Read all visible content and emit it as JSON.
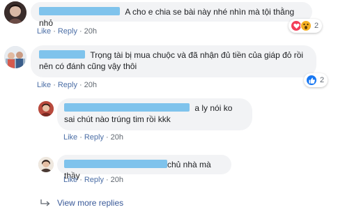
{
  "comments": [
    {
      "text": "A cho e chia se bài này nhé nhìn mà tội thằng nhỏ",
      "actions": {
        "like": "Like",
        "reply": "Reply",
        "time": "20h"
      },
      "reactions": {
        "count": "2",
        "icons": [
          "love-icon",
          "wow-icon"
        ],
        "colors": [
          "#f33e58",
          "#f7b125"
        ]
      }
    },
    {
      "text": "Trọng tài bị mua chuộc và đã nhận đủ tiền của giáp đỏ rồi nên có đánh cũng vậy thôi",
      "actions": {
        "like": "Like",
        "reply": "Reply",
        "time": "20h"
      },
      "reactions": {
        "count": "2",
        "icons": [
          "like-icon"
        ],
        "colors": [
          "#1877f2"
        ]
      }
    }
  ],
  "replies": [
    {
      "text": "a ly nói ko sai chút nào trúng tim rồi kkk",
      "actions": {
        "like": "Like",
        "reply": "Reply",
        "time": "20h"
      }
    },
    {
      "text": "chủ nhà mà thầy",
      "actions": {
        "like": "Like",
        "reply": "Reply",
        "time": "20h"
      }
    }
  ],
  "view_more": "View more replies",
  "colors": {
    "bubble": "#f2f3f5",
    "link": "#385898",
    "name_redaction": "#7fc3ec"
  }
}
